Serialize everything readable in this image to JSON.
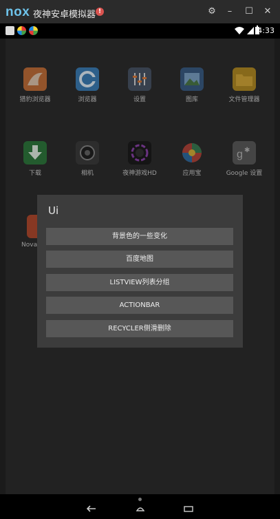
{
  "window": {
    "logo": "nox",
    "title": "夜神安卓模拟器",
    "alert_icon": "exclamation-icon",
    "controls": [
      "gear-icon",
      "minimize-icon",
      "maximize-icon",
      "close-icon"
    ]
  },
  "status_bar": {
    "time": "4:33",
    "left_icons": [
      "gallery-notification-icon",
      "app-notification-icon",
      "app-notification-icon"
    ],
    "right_icons": [
      "wifi-icon",
      "signal-icon",
      "battery-icon"
    ]
  },
  "launcher": {
    "apps": [
      {
        "label": "猎豹浏览器",
        "icon": "cheetah-browser-icon",
        "color": "#c5703a"
      },
      {
        "label": "浏览器",
        "icon": "browser-icon",
        "color": "#3c7fb8"
      },
      {
        "label": "设置",
        "icon": "settings-icon",
        "color": "#4a5667"
      },
      {
        "label": "图库",
        "icon": "gallery-icon",
        "color": "#3b5e86"
      },
      {
        "label": "文件管理器",
        "icon": "folder-icon",
        "color": "#b58d25"
      },
      {
        "label": "下载",
        "icon": "download-icon",
        "color": "#2f7a3e"
      },
      {
        "label": "相机",
        "icon": "camera-icon",
        "color": "#3d3d3d"
      },
      {
        "label": "夜神游戏HD",
        "icon": "nox-game-icon",
        "color": "#1c1c1c"
      },
      {
        "label": "应用宝",
        "icon": "app-store-icon",
        "color": "#3a7e55"
      },
      {
        "label": "Google 设置",
        "icon": "google-settings-icon",
        "color": "#5c5c5c"
      },
      {
        "label": "Nova",
        "icon": "nova-icon",
        "color": "#b44b2f"
      }
    ]
  },
  "dialog": {
    "title": "Ui",
    "items": [
      "背景色的一些变化",
      "百度地图",
      "LISTVIEW列表分组",
      "ACTIONBAR",
      "RECYCLER侧滑删除"
    ]
  },
  "nav_bar": {
    "buttons": [
      "back-icon",
      "home-icon",
      "recents-icon"
    ]
  }
}
